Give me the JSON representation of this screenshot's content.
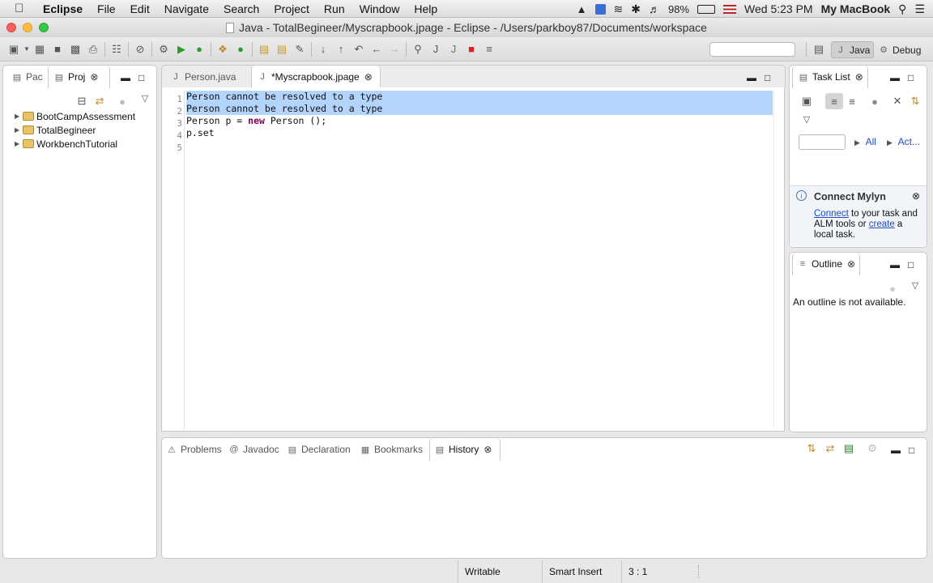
{
  "menubar": {
    "app_name": "Eclipse",
    "items": [
      "File",
      "Edit",
      "Navigate",
      "Search",
      "Project",
      "Run",
      "Window",
      "Help"
    ],
    "battery": "98%",
    "clock": "Wed 5:23 PM",
    "user": "My MacBook"
  },
  "window": {
    "title": "Java - TotalBegineer/Myscrapbook.jpage - Eclipse - /Users/parkboy87/Documents/workspace"
  },
  "perspectives": {
    "java": "Java",
    "debug": "Debug"
  },
  "left_panel": {
    "tabs": [
      "Pac",
      "Proj"
    ],
    "projects": [
      "BootCampAssessment",
      "TotalBegineer",
      "WorkbenchTutorial"
    ]
  },
  "editor": {
    "tabs": [
      "Person.java",
      "*Myscrapbook.jpage"
    ],
    "lines": [
      {
        "num": "1",
        "text": "Person cannot be resolved to a type",
        "selected": true
      },
      {
        "num": "2",
        "text": "Person cannot be resolved to a type",
        "selected": true
      },
      {
        "num": "3",
        "pre": "Person p = ",
        "kw": "new",
        "post": " Person ();",
        "selected": false
      },
      {
        "num": "4",
        "text": "p.set",
        "selected": false
      },
      {
        "num": "5",
        "text": "",
        "selected": false
      }
    ]
  },
  "task_list": {
    "title": "Task List",
    "filter_all": "All",
    "filter_act": "Act..."
  },
  "mylyn": {
    "title": "Connect Mylyn",
    "connect_link": "Connect",
    "text1": " to your task and ALM tools or ",
    "create_link": "create",
    "text2": " a local task."
  },
  "outline": {
    "title": "Outline",
    "message": "An outline is not available."
  },
  "bottom_panel": {
    "tabs": [
      "Problems",
      "Javadoc",
      "Declaration",
      "Bookmarks",
      "History"
    ]
  },
  "status": {
    "writable": "Writable",
    "insert_mode": "Smart Insert",
    "position": "3 : 1"
  },
  "colors": {
    "selection": "#b3d4fd",
    "keyword": "#7f0055",
    "link": "#1a4ec7"
  }
}
